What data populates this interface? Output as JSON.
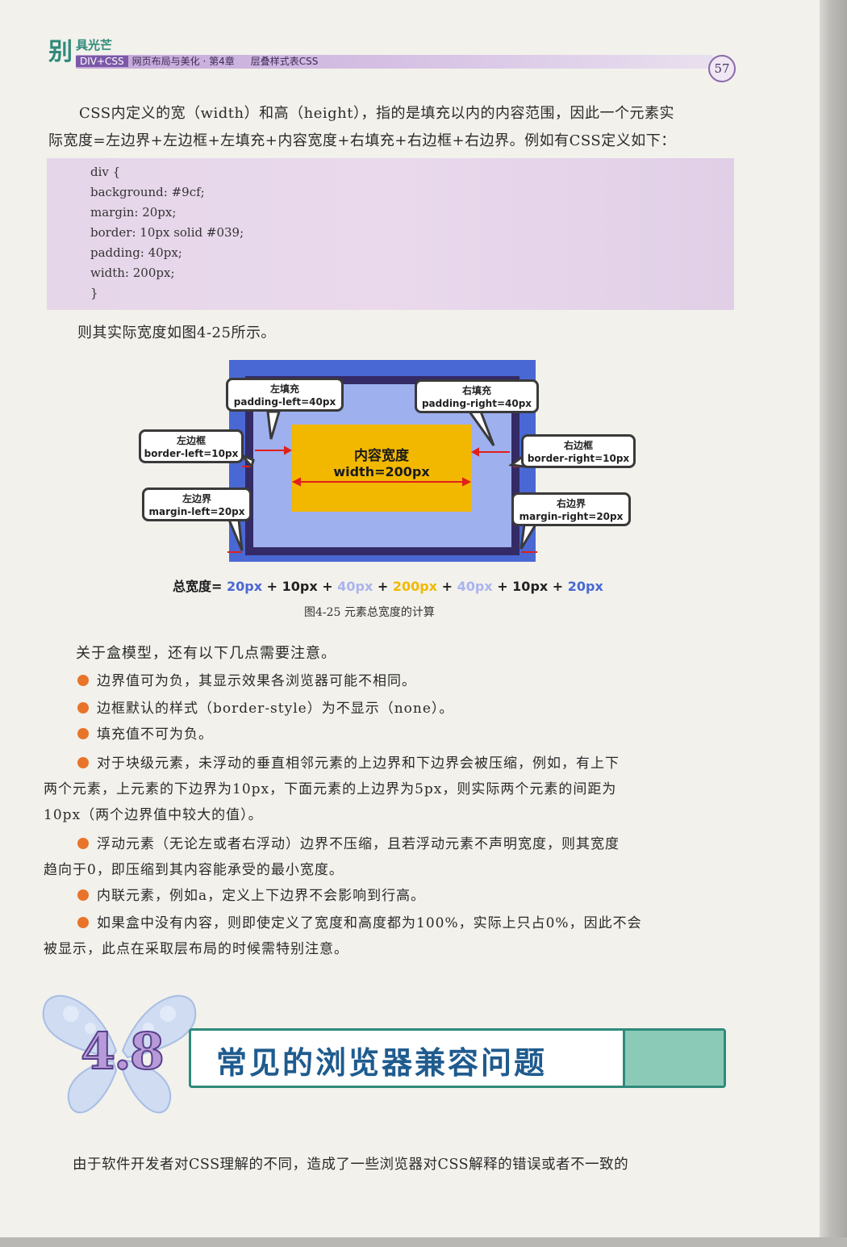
{
  "header": {
    "logo_char": "别",
    "logo_rest": "具光芒",
    "tag": "DIV+CSS",
    "book": "网页布局与美化 · 第4章",
    "section": "层叠样式表CSS",
    "page_number": "57"
  },
  "intro": {
    "line1": "CSS内定义的宽（width）和高（height），指的是填充以内的内容范围，因此一个元素实",
    "line2": "际宽度=左边界+左边框+左填充+内容宽度+右填充+右边框+右边界。例如有CSS定义如下："
  },
  "code_lines": [
    "div {",
    "background: #9cf;",
    "margin: 20px;",
    "border: 10px solid #039;",
    "padding: 40px;",
    "width: 200px;",
    "}"
  ],
  "after_code": "则其实际宽度如图4-25所示。",
  "figure": {
    "colors": {
      "margin": "#4a68d4",
      "border": "#332a66",
      "padding": "#9fb0ef",
      "content": "#f2b800"
    },
    "content_label": "内容宽度",
    "content_value": "width=200px",
    "labels": {
      "padding_left_title": "左填充",
      "padding_left": "padding-left=40px",
      "padding_right_title": "右填充",
      "padding_right": "padding-right=40px",
      "border_left_title": "左边框",
      "border_left": "border-left=10px",
      "border_right_title": "右边框",
      "border_right": "border-right=10px",
      "margin_left_title": "左边界",
      "margin_left": "margin-left=20px",
      "margin_right_title": "右边界",
      "margin_right": "margin-right=20px"
    },
    "total_label": "总宽度=",
    "total_terms": [
      "20px",
      "10px",
      "40px",
      "200px",
      "40px",
      "10px",
      "20px"
    ],
    "plus": "+",
    "caption": "图4-25    元素总宽度的计算"
  },
  "notes_intro": "关于盒模型，还有以下几点需要注意。",
  "notes": {
    "n1": "边界值可为负，其显示效果各浏览器可能不相同。",
    "n2": "边框默认的样式（border-style）为不显示（none）。",
    "n3": "填充值不可为负。",
    "n4a": "对于块级元素，未浮动的垂直相邻元素的上边界和下边界会被压缩，例如，有上下",
    "n4b": "两个元素，上元素的下边界为10px，下面元素的上边界为5px，则实际两个元素的间距为",
    "n4c": "10px（两个边界值中较大的值）。",
    "n5a": "浮动元素（无论左或者右浮动）边界不压缩，且若浮动元素不声明宽度，则其宽度",
    "n5b": "趋向于0，即压缩到其内容能承受的最小宽度。",
    "n6": "内联元素，例如a，定义上下边界不会影响到行高。",
    "n7a": "如果盒中没有内容，则即使定义了宽度和高度都为100%，实际上只占0%，因此不会",
    "n7b": "被显示，此点在采取层布局的时候需特别注意。"
  },
  "section": {
    "number": "4.8",
    "title": "常见的浏览器兼容问题"
  },
  "closing": "由于软件开发者对CSS理解的不同，造成了一些浏览器对CSS解释的错误或者不一致的"
}
